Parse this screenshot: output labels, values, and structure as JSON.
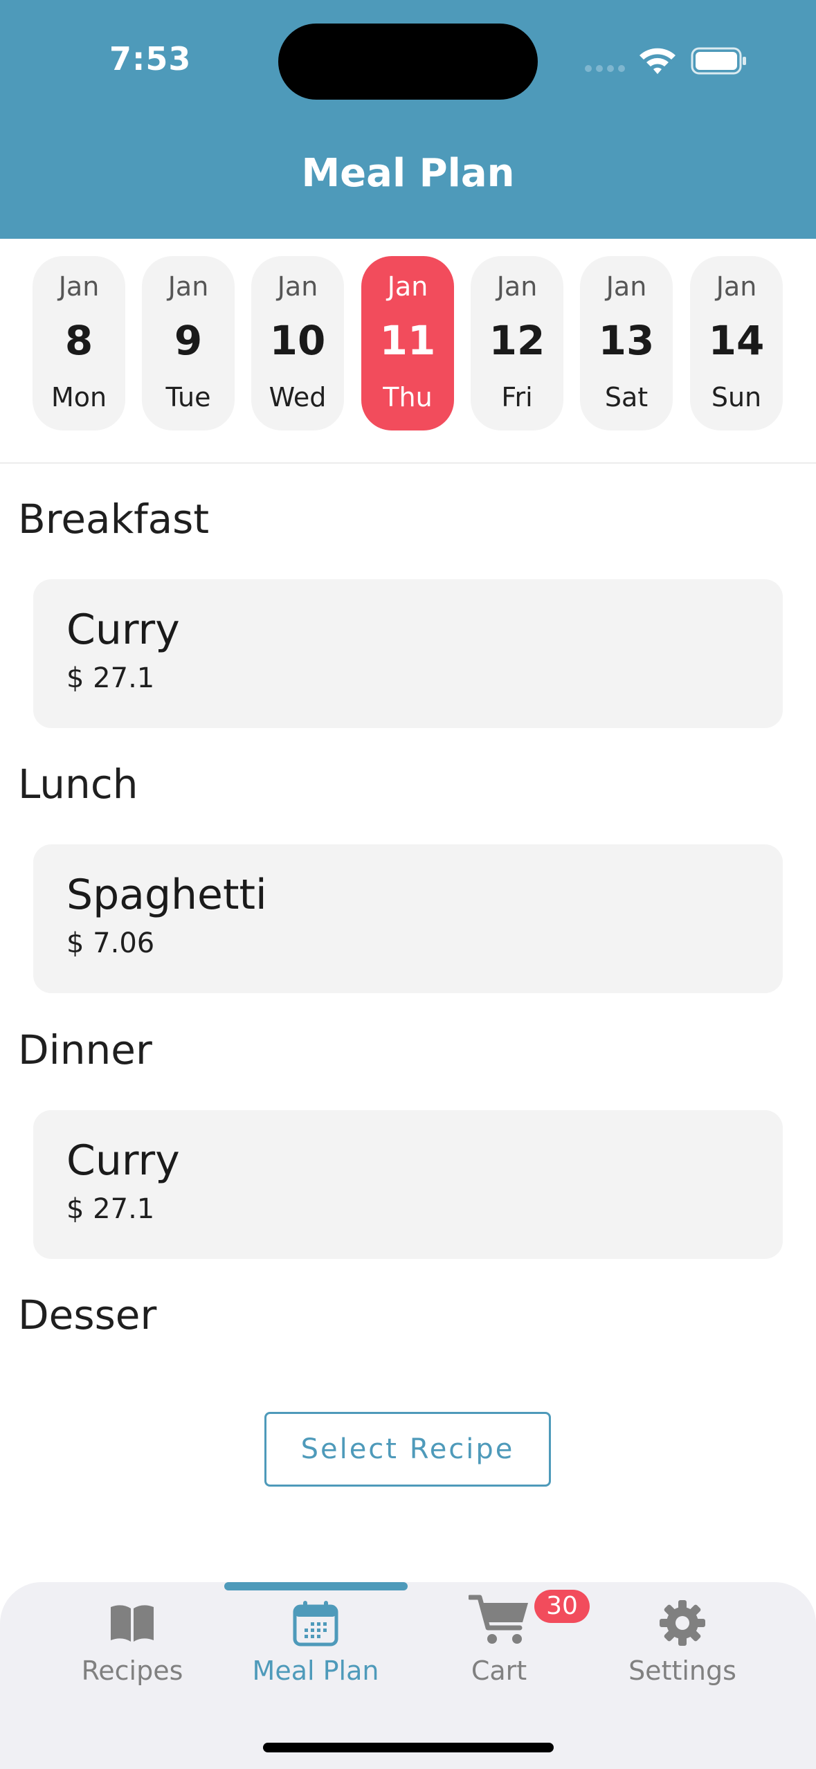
{
  "status_bar": {
    "time": "7:53"
  },
  "header": {
    "title": "Meal Plan",
    "color": "#4e9aba"
  },
  "days": [
    {
      "month": "Jan",
      "day": "8",
      "weekday": "Mon",
      "selected": false
    },
    {
      "month": "Jan",
      "day": "9",
      "weekday": "Tue",
      "selected": false
    },
    {
      "month": "Jan",
      "day": "10",
      "weekday": "Wed",
      "selected": false
    },
    {
      "month": "Jan",
      "day": "11",
      "weekday": "Thu",
      "selected": true
    },
    {
      "month": "Jan",
      "day": "12",
      "weekday": "Fri",
      "selected": false
    },
    {
      "month": "Jan",
      "day": "13",
      "weekday": "Sat",
      "selected": false
    },
    {
      "month": "Jan",
      "day": "14",
      "weekday": "Sun",
      "selected": false
    }
  ],
  "meals": {
    "breakfast": {
      "title": "Breakfast",
      "recipe": "Curry",
      "price": "$ 27.1"
    },
    "lunch": {
      "title": "Lunch",
      "recipe": "Spaghetti",
      "price": "$ 7.06"
    },
    "dinner": {
      "title": "Dinner",
      "recipe": "Curry",
      "price": "$ 27.1"
    },
    "dessert": {
      "title": "Desser",
      "button_label": "Select Recipe"
    }
  },
  "tabbar": {
    "tabs": [
      {
        "label": "Recipes",
        "icon": "book-icon",
        "active": false
      },
      {
        "label": "Meal Plan",
        "icon": "calendar-icon",
        "active": true
      },
      {
        "label": "Cart",
        "icon": "cart-icon",
        "active": false,
        "badge": "30"
      },
      {
        "label": "Settings",
        "icon": "gear-icon",
        "active": false
      }
    ]
  },
  "colors": {
    "accent": "#4e9aba",
    "selected_day": "#f24c5c",
    "badge": "#f24c5c"
  }
}
